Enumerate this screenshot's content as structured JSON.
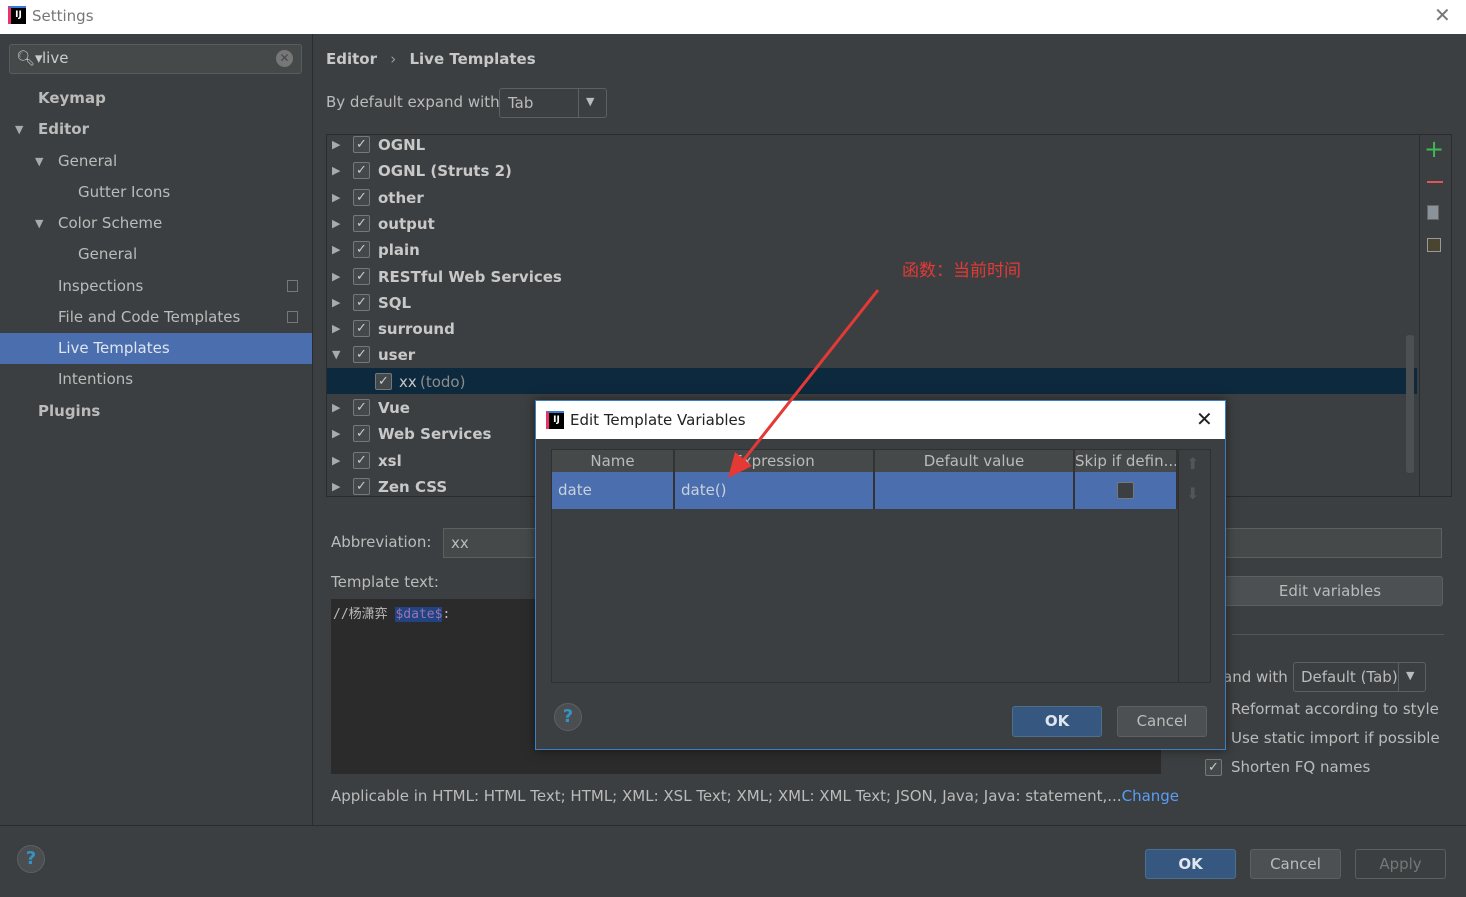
{
  "window": {
    "title": "Settings",
    "close_icon": "close-icon"
  },
  "search": {
    "value": "live"
  },
  "sidebar": {
    "items": [
      {
        "label": "Keymap"
      },
      {
        "label": "Editor"
      },
      {
        "label": "General"
      },
      {
        "label": "Gutter Icons"
      },
      {
        "label": "Color Scheme"
      },
      {
        "label": "General"
      },
      {
        "label": "Inspections"
      },
      {
        "label": "File and Code Templates"
      },
      {
        "label": "Live Templates"
      },
      {
        "label": "Intentions"
      },
      {
        "label": "Plugins"
      }
    ]
  },
  "breadcrumb": {
    "parent": "Editor",
    "sep": "›",
    "current": "Live Templates"
  },
  "expand": {
    "label": "By default expand with",
    "value": "Tab"
  },
  "tree": {
    "groups": [
      "OGNL",
      "OGNL (Struts 2)",
      "other",
      "output",
      "plain",
      "RESTful Web Services",
      "SQL",
      "surround",
      "user",
      "Vue",
      "Web Services",
      "xsl",
      "Zen CSS"
    ],
    "child": {
      "name": "xx",
      "desc": "(todo)"
    }
  },
  "annotation": "函数：当前时间",
  "editor": {
    "abbreviation_label": "Abbreviation:",
    "abbreviation": "xx",
    "template_label": "Template text:",
    "template_prefix": "//杨潇弈 ",
    "template_var": "$date$",
    "template_suffix": ":",
    "edit_variables": "Edit variables",
    "expand_label": "and with",
    "expand_value": "Default (Tab)",
    "opt_reformat": "Reformat according to style",
    "opt_static": "Use static import if possible",
    "opt_shorten": "Shorten FQ names",
    "applicable": "Applicable in HTML: HTML Text; HTML; XML: XSL Text; XML; XML: XML Text; JSON, Java; Java: statement,...",
    "change": "Change"
  },
  "dialog": {
    "title": "Edit Template Variables",
    "columns": [
      "Name",
      "Expression",
      "Default value",
      "Skip if defin..."
    ],
    "rows": [
      {
        "name": "date",
        "expression": "date()",
        "default": "",
        "skip": false
      }
    ],
    "ok": "OK",
    "cancel": "Cancel",
    "help": "?"
  },
  "footer": {
    "ok": "OK",
    "cancel": "Cancel",
    "apply": "Apply",
    "help": "?"
  },
  "colors": {
    "accent": "#4b6eaf",
    "annotation": "#e53935",
    "add": "#3fb950",
    "remove": "#e05555"
  }
}
